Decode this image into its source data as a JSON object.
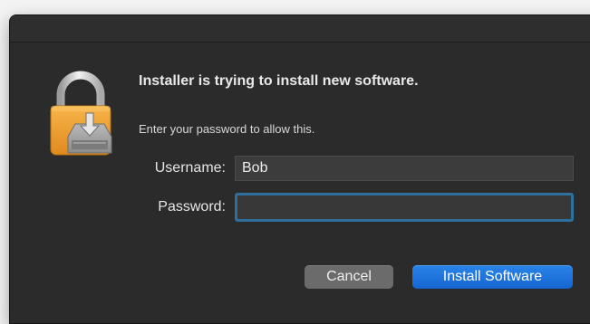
{
  "dialog": {
    "headline": "Installer is trying to install new software.",
    "subtext": "Enter your password to allow this.",
    "icon": "lock-with-installer-icon",
    "username": {
      "label": "Username:",
      "value": "Bob"
    },
    "password": {
      "label": "Password:",
      "value": "",
      "focused": true
    },
    "buttons": {
      "cancel": "Cancel",
      "install": "Install Software"
    }
  },
  "colors": {
    "dialog_background": "#2b2b2b",
    "accent": "#1a6fdd",
    "focus_ring": "#2f6f9e",
    "lock_body": "#f0a53a",
    "lock_shackle": "#c9c9c9"
  }
}
